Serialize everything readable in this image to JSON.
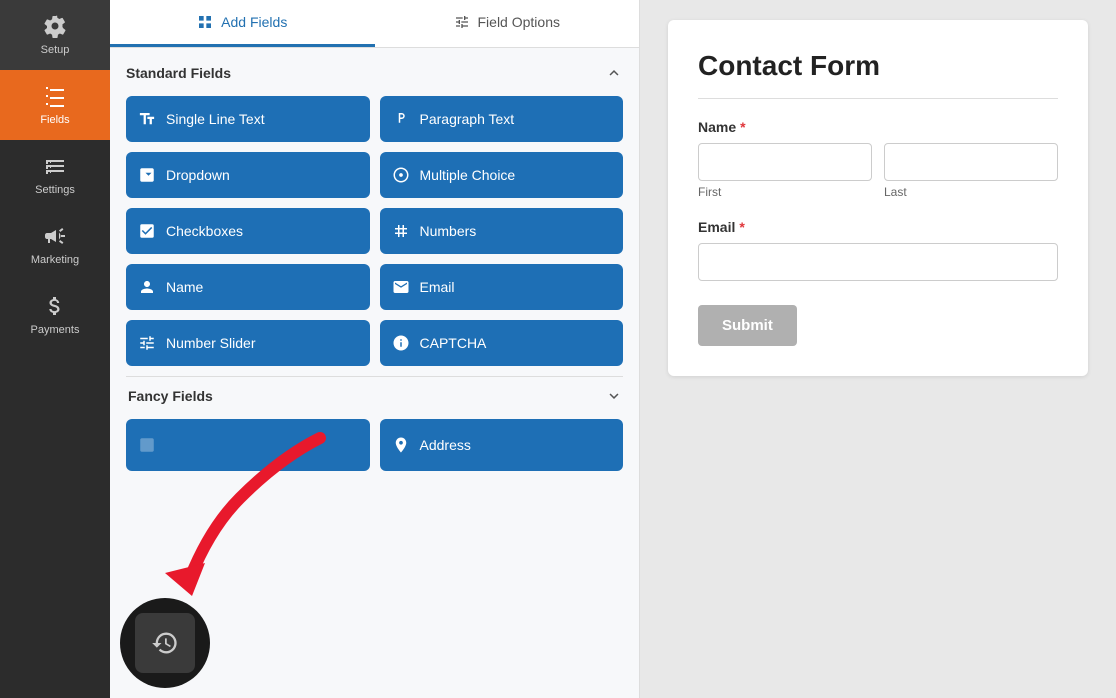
{
  "sidebar": {
    "items": [
      {
        "label": "Setup",
        "icon": "gear"
      },
      {
        "label": "Fields",
        "icon": "fields",
        "active": true
      },
      {
        "label": "Settings",
        "icon": "settings"
      },
      {
        "label": "Marketing",
        "icon": "marketing"
      },
      {
        "label": "Payments",
        "icon": "payments"
      }
    ]
  },
  "tabs": [
    {
      "label": "Add Fields",
      "icon": "grid",
      "active": true
    },
    {
      "label": "Field Options",
      "icon": "sliders",
      "active": false
    }
  ],
  "standard_fields": {
    "section_label": "Standard Fields",
    "buttons": [
      {
        "label": "Single Line Text",
        "icon": "text-line"
      },
      {
        "label": "Paragraph Text",
        "icon": "paragraph"
      },
      {
        "label": "Dropdown",
        "icon": "dropdown"
      },
      {
        "label": "Multiple Choice",
        "icon": "radio"
      },
      {
        "label": "Checkboxes",
        "icon": "checkbox"
      },
      {
        "label": "Numbers",
        "icon": "hash"
      },
      {
        "label": "Name",
        "icon": "person"
      },
      {
        "label": "Email",
        "icon": "envelope"
      },
      {
        "label": "Number Slider",
        "icon": "slider"
      },
      {
        "label": "CAPTCHA",
        "icon": "captcha"
      }
    ]
  },
  "fancy_fields": {
    "section_label": "Fancy Fields",
    "buttons": [
      {
        "label": "",
        "icon": "blank"
      },
      {
        "label": "Address",
        "icon": "pin"
      }
    ]
  },
  "form_preview": {
    "title": "Contact Form",
    "fields": [
      {
        "label": "Name",
        "required": true,
        "type": "name",
        "sub_fields": [
          {
            "placeholder": "",
            "sub_label": "First"
          },
          {
            "placeholder": "",
            "sub_label": "Last"
          }
        ]
      },
      {
        "label": "Email",
        "required": true,
        "type": "email",
        "placeholder": ""
      }
    ],
    "submit_label": "Submit"
  }
}
